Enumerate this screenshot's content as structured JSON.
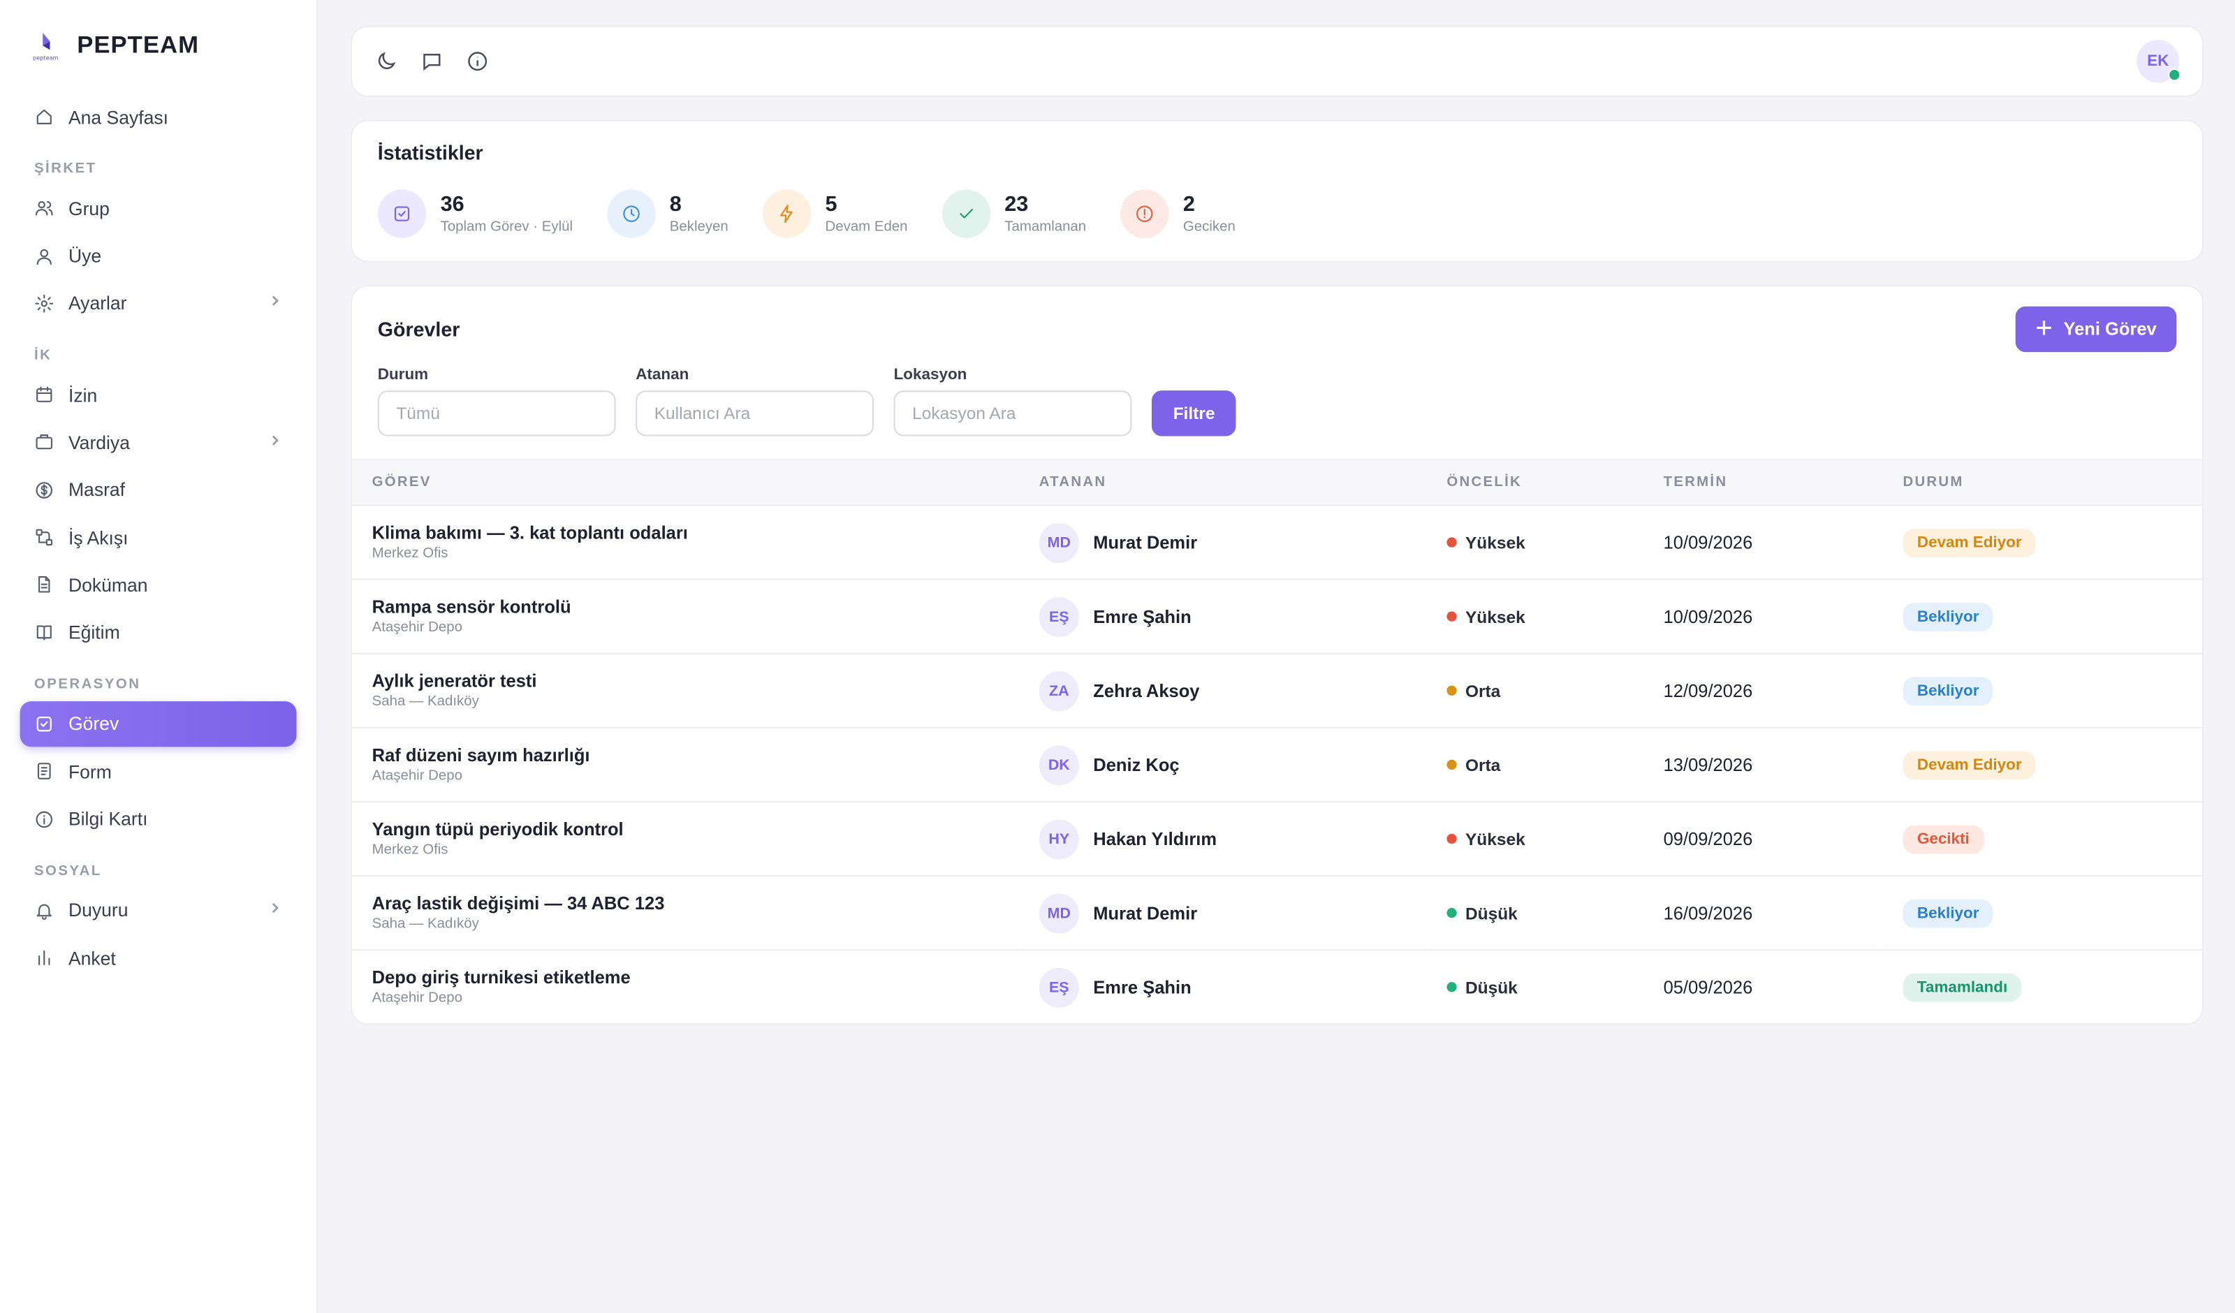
{
  "brand": {
    "name": "PEPTEAM",
    "logo_caption": "pepteam"
  },
  "sidebar": {
    "top": [
      {
        "label": "Ana Sayfası",
        "icon": "home-icon"
      }
    ],
    "sections": [
      {
        "title": "ŞİRKET",
        "items": [
          {
            "label": "Grup",
            "icon": "users-icon",
            "chevron": false
          },
          {
            "label": "Üye",
            "icon": "user-icon",
            "chevron": false
          },
          {
            "label": "Ayarlar",
            "icon": "gear-icon",
            "chevron": true
          }
        ]
      },
      {
        "title": "İK",
        "items": [
          {
            "label": "İzin",
            "icon": "calendar-icon",
            "chevron": false
          },
          {
            "label": "Vardiya",
            "icon": "briefcase-icon",
            "chevron": true
          },
          {
            "label": "Masraf",
            "icon": "dollar-icon",
            "chevron": false
          },
          {
            "label": "İş Akışı",
            "icon": "workflow-icon",
            "chevron": false
          },
          {
            "label": "Doküman",
            "icon": "document-icon",
            "chevron": false
          },
          {
            "label": "Eğitim",
            "icon": "book-icon",
            "chevron": false
          }
        ]
      },
      {
        "title": "OPERASYON",
        "items": [
          {
            "label": "Görev",
            "icon": "checkbox-icon",
            "chevron": false,
            "active": true
          },
          {
            "label": "Form",
            "icon": "form-icon",
            "chevron": false
          },
          {
            "label": "Bilgi Kartı",
            "icon": "info-icon",
            "chevron": false
          }
        ]
      },
      {
        "title": "SOSYAL",
        "items": [
          {
            "label": "Duyuru",
            "icon": "bell-icon",
            "chevron": true
          },
          {
            "label": "Anket",
            "icon": "bar-chart-icon",
            "chevron": false
          }
        ]
      }
    ]
  },
  "topbar": {
    "user_initials": "EK"
  },
  "stats": {
    "title": "İstatistikler",
    "items": [
      {
        "value": "36",
        "label": "Toplam Görev · Eylül",
        "icon": "checkbox-icon",
        "color": "#7b63ea",
        "bg": "#ece8fd"
      },
      {
        "value": "8",
        "label": "Bekleyen",
        "icon": "clock-icon",
        "color": "#3d8fd6",
        "bg": "#e6f1fb"
      },
      {
        "value": "5",
        "label": "Devam Eden",
        "icon": "bolt-icon",
        "color": "#e08a1e",
        "bg": "#fdf0df"
      },
      {
        "value": "23",
        "label": "Tamamlanan",
        "icon": "check-icon",
        "color": "#1f9c74",
        "bg": "#e2f3ee"
      },
      {
        "value": "2",
        "label": "Geciken",
        "icon": "alert-icon",
        "color": "#e2603f",
        "bg": "#fde9e3"
      }
    ]
  },
  "tasks": {
    "title": "Görevler",
    "new_button": "Yeni Görev",
    "filters": {
      "status": {
        "label": "Durum",
        "placeholder": "Tümü"
      },
      "assignee": {
        "label": "Atanan",
        "placeholder": "Kullanıcı Ara"
      },
      "location": {
        "label": "Lokasyon",
        "placeholder": "Lokasyon Ara"
      },
      "button": "Filtre"
    },
    "columns": [
      "GÖREV",
      "ATANAN",
      "ÖNCELİK",
      "TERMİN",
      "DURUM"
    ],
    "rows": [
      {
        "title": "Klima bakımı — 3. kat toplantı odaları",
        "location": "Merkez Ofis",
        "initials": "MD",
        "assignee": "Murat Demir",
        "priority": "Yüksek",
        "priority_color": "#e5533d",
        "due": "10/09/2026",
        "status": "Devam Ediyor",
        "status_fg": "#d4870f",
        "status_bg": "#fdf1dd"
      },
      {
        "title": "Rampa sensör kontrolü",
        "location": "Ataşehir Depo",
        "initials": "EŞ",
        "assignee": "Emre Şahin",
        "priority": "Yüksek",
        "priority_color": "#e5533d",
        "due": "10/09/2026",
        "status": "Bekliyor",
        "status_fg": "#2a7fc9",
        "status_bg": "#e4f0fb"
      },
      {
        "title": "Aylık jeneratör testi",
        "location": "Saha — Kadıköy",
        "initials": "ZA",
        "assignee": "Zehra Aksoy",
        "priority": "Orta",
        "priority_color": "#d99218",
        "due": "12/09/2026",
        "status": "Bekliyor",
        "status_fg": "#2a7fc9",
        "status_bg": "#e4f0fb"
      },
      {
        "title": "Raf düzeni sayım hazırlığı",
        "location": "Ataşehir Depo",
        "initials": "DK",
        "assignee": "Deniz Koç",
        "priority": "Orta",
        "priority_color": "#d99218",
        "due": "13/09/2026",
        "status": "Devam Ediyor",
        "status_fg": "#d4870f",
        "status_bg": "#fdf1dd"
      },
      {
        "title": "Yangın tüpü periyodik kontrol",
        "location": "Merkez Ofis",
        "initials": "HY",
        "assignee": "Hakan Yıldırım",
        "priority": "Yüksek",
        "priority_color": "#e5533d",
        "due": "09/09/2026",
        "status": "Gecikti",
        "status_fg": "#df5a3a",
        "status_bg": "#fde8e1"
      },
      {
        "title": "Araç lastik değişimi — 34 ABC 123",
        "location": "Saha — Kadıköy",
        "initials": "MD",
        "assignee": "Murat Demir",
        "priority": "Düşük",
        "priority_color": "#22b07d",
        "due": "16/09/2026",
        "status": "Bekliyor",
        "status_fg": "#2a7fc9",
        "status_bg": "#e4f0fb"
      },
      {
        "title": "Depo giriş turnikesi etiketleme",
        "location": "Ataşehir Depo",
        "initials": "EŞ",
        "assignee": "Emre Şahin",
        "priority": "Düşük",
        "priority_color": "#22b07d",
        "due": "05/09/2026",
        "status": "Tamamlandı",
        "status_fg": "#17946b",
        "status_bg": "#dff3ec"
      }
    ]
  }
}
